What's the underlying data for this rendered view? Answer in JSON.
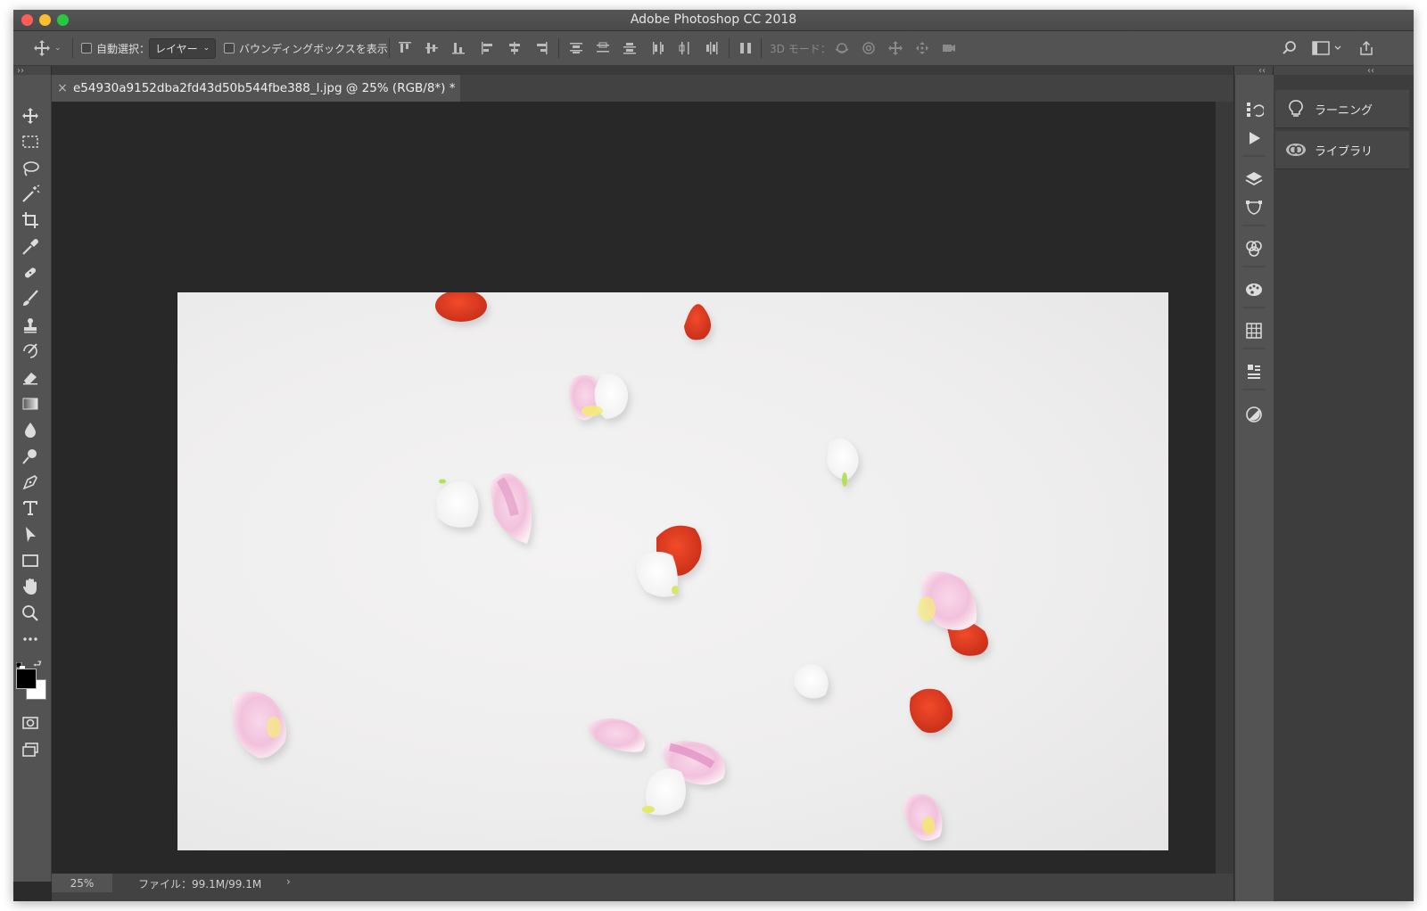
{
  "window": {
    "title": "Adobe Photoshop CC 2018"
  },
  "options_bar": {
    "auto_select_label": "自動選択：",
    "auto_select_value": "レイヤー",
    "bounding_box_label": "バウンディングボックスを表示",
    "mode_3d_label": "3D モード："
  },
  "document": {
    "tab_title": "e54930a9152dba2fd43d50b544fbe388_l.jpg @ 25% (RGB/8*) *",
    "zoom": "25%",
    "file_size": "ファイル：99.1M/99.1M",
    "arrow": "›"
  },
  "right_panels": {
    "items": [
      {
        "label": "ラーニング",
        "icon": "lightbulb-icon"
      },
      {
        "label": "ライブラリ",
        "icon": "cc-libraries-icon"
      }
    ]
  },
  "tools": [
    "move-tool",
    "marquee-tool",
    "lasso-tool",
    "magic-wand-tool",
    "crop-tool",
    "eyedropper-tool",
    "healing-brush-tool",
    "brush-tool",
    "clone-stamp-tool",
    "history-brush-tool",
    "eraser-tool",
    "gradient-tool",
    "blur-tool",
    "dodge-tool",
    "pen-tool",
    "type-tool",
    "path-selection-tool",
    "rectangle-tool",
    "hand-tool",
    "zoom-tool",
    "edit-toolbar"
  ],
  "colors": {
    "foreground": "#000000",
    "background": "#ffffff",
    "ui_dark": "#282828",
    "ui_panel": "#535353"
  }
}
